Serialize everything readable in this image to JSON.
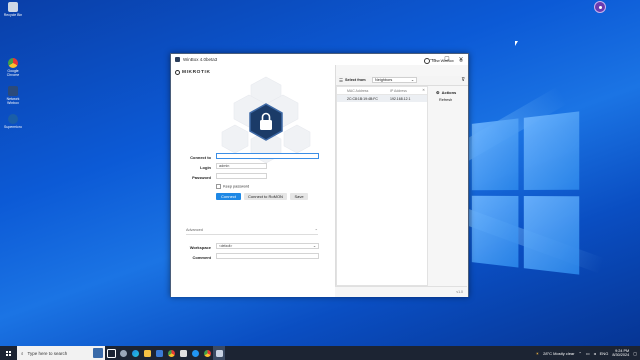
{
  "desktop": {
    "icons": [
      {
        "label": "Recycle Bin"
      },
      {
        "label": "Google Chrome"
      },
      {
        "label": "Network Winbox"
      },
      {
        "label": "Supermicro"
      }
    ]
  },
  "window": {
    "title": "WinBox 4.0beta3",
    "controls": {
      "minimize": "—",
      "maximize": "☐",
      "close": "✕"
    }
  },
  "brand": {
    "name": "MikroTik"
  },
  "form": {
    "connect_to_label": "Connect to",
    "connect_to_value": "",
    "login_label": "Login",
    "login_value": "admin",
    "password_label": "Password",
    "password_value": "",
    "keep_password_label": "Keep password",
    "connect_button": "Connect",
    "romon_button": "Connect to RoMON",
    "save_button": "Save",
    "advanced_label": "Advanced",
    "workspace_label": "Workspace",
    "workspace_value": "<default>",
    "comment_label": "Comment",
    "comment_value": ""
  },
  "right_panel": {
    "new_winbox": "New WinBox",
    "select_from_label": "Select from",
    "select_from_value": "Neighbors",
    "columns": [
      "MAC Address",
      "IP Address"
    ],
    "rows": [
      {
        "mac": "2C:C8:1B:19:4B:FC",
        "ip": "192.168.12.1"
      }
    ],
    "actions_title": "Actions",
    "refresh": "Refresh",
    "footer_version": "v1.0"
  },
  "taskbar": {
    "search_placeholder": "Type here to search",
    "weather": "28°C  Mostly clear",
    "language": "ENG",
    "time": "9:24 PM",
    "date": "8/30/2024"
  },
  "colors": {
    "accent": "#1e88e5",
    "shield": "#1b3b68",
    "taskbar": "#1c2433"
  }
}
